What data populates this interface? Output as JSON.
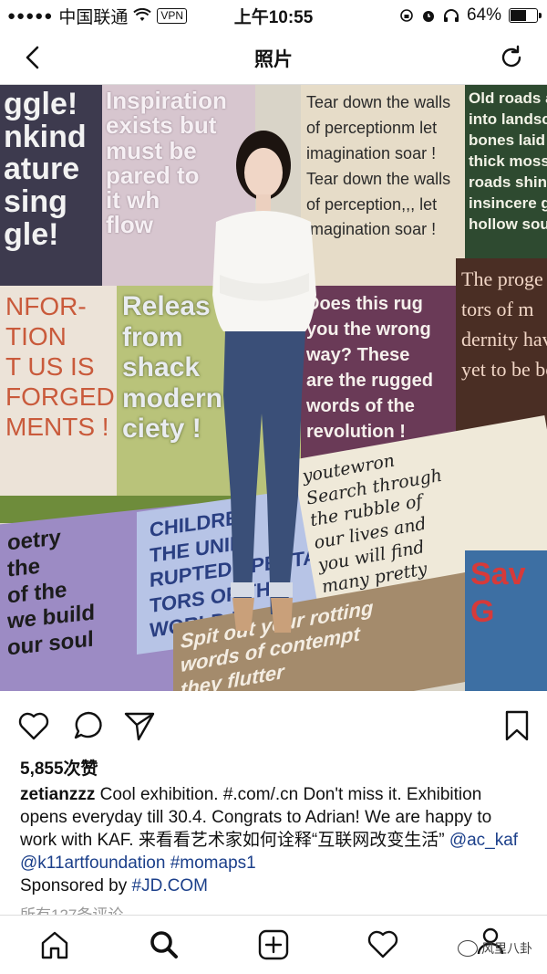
{
  "status": {
    "carrier": "中国联通",
    "signal": "●●●●●",
    "vpn": "VPN",
    "time": "上午10:55",
    "battery": "64%",
    "battery_level": 0.64
  },
  "nav": {
    "title": "照片",
    "back_icon": "chevron-left-icon",
    "refresh_icon": "refresh-icon"
  },
  "photo": {
    "panels": {
      "p1": "ggle!\nnkind\nature\nsing\ngle!",
      "p2": "Inspiration\nexists but\nmust be\npared to\nit wh\nflow",
      "p3": "Tear down the walls\nof perceptionm let\nimagination soar !\nTear down the walls\nof perception,,, let\nimagination soar !",
      "p4": "Old roads are\ninto landsca\nbones laid to\nthick moss,\nroads shine w\ninsincere gl\nhollow soul",
      "p5": "NFOR-\nTION\nT US IS\nFORGED\nMENTS !",
      "p6": "Releas\nfrom\nshack\nmodern\nciety !",
      "p7": "Does this rug\nyou the wrong\nway? These\nare the rugged\nwords of the\nrevolution !",
      "p8": "The proge\ntors of m\ndernity hav\nyet to be bor",
      "p9": "oetry\nthe\nof the\nwe build\nour soul",
      "p10": "CHILDRE\nTHE UNIN\nRUPTED SPECTA-\nTORS OF THE\nWORLD !",
      "p11": "youtewron\nSearch through\nthe rubble of\nour lives and\nyou will find\nmany pretty\nthings",
      "p12": "Spit out your rotting\nwords of contempt\nthey flutter\nin the",
      "p13": "Sav\nG"
    }
  },
  "actions": {
    "like_icon": "heart-icon",
    "comment_icon": "comment-icon",
    "share_icon": "send-icon",
    "save_icon": "bookmark-icon"
  },
  "post": {
    "likes": "5,855次赞",
    "username": "zetianzzz",
    "caption_text": " Cool exhibition. #.com/.cn  Don't miss it. Exhibition opens everyday till 30.4. Congrats to Adrian!  We are happy to work with KAF. 来看看艺术家如何诠释“互联网改变生活” ",
    "mention1": "@ac_kaf",
    "mention2": "@k11artfoundation",
    "hashtag1": "#momaps1",
    "sponsored_prefix": "Sponsored by ",
    "hashtag2": "#JD.COM",
    "comments_link": "所有127条评论"
  },
  "tabs": {
    "home_icon": "home-icon",
    "search_icon": "search-icon",
    "add_icon": "add-post-icon",
    "activity_icon": "heart-icon",
    "profile_icon": "profile-icon",
    "watermark": "风里八卦"
  }
}
